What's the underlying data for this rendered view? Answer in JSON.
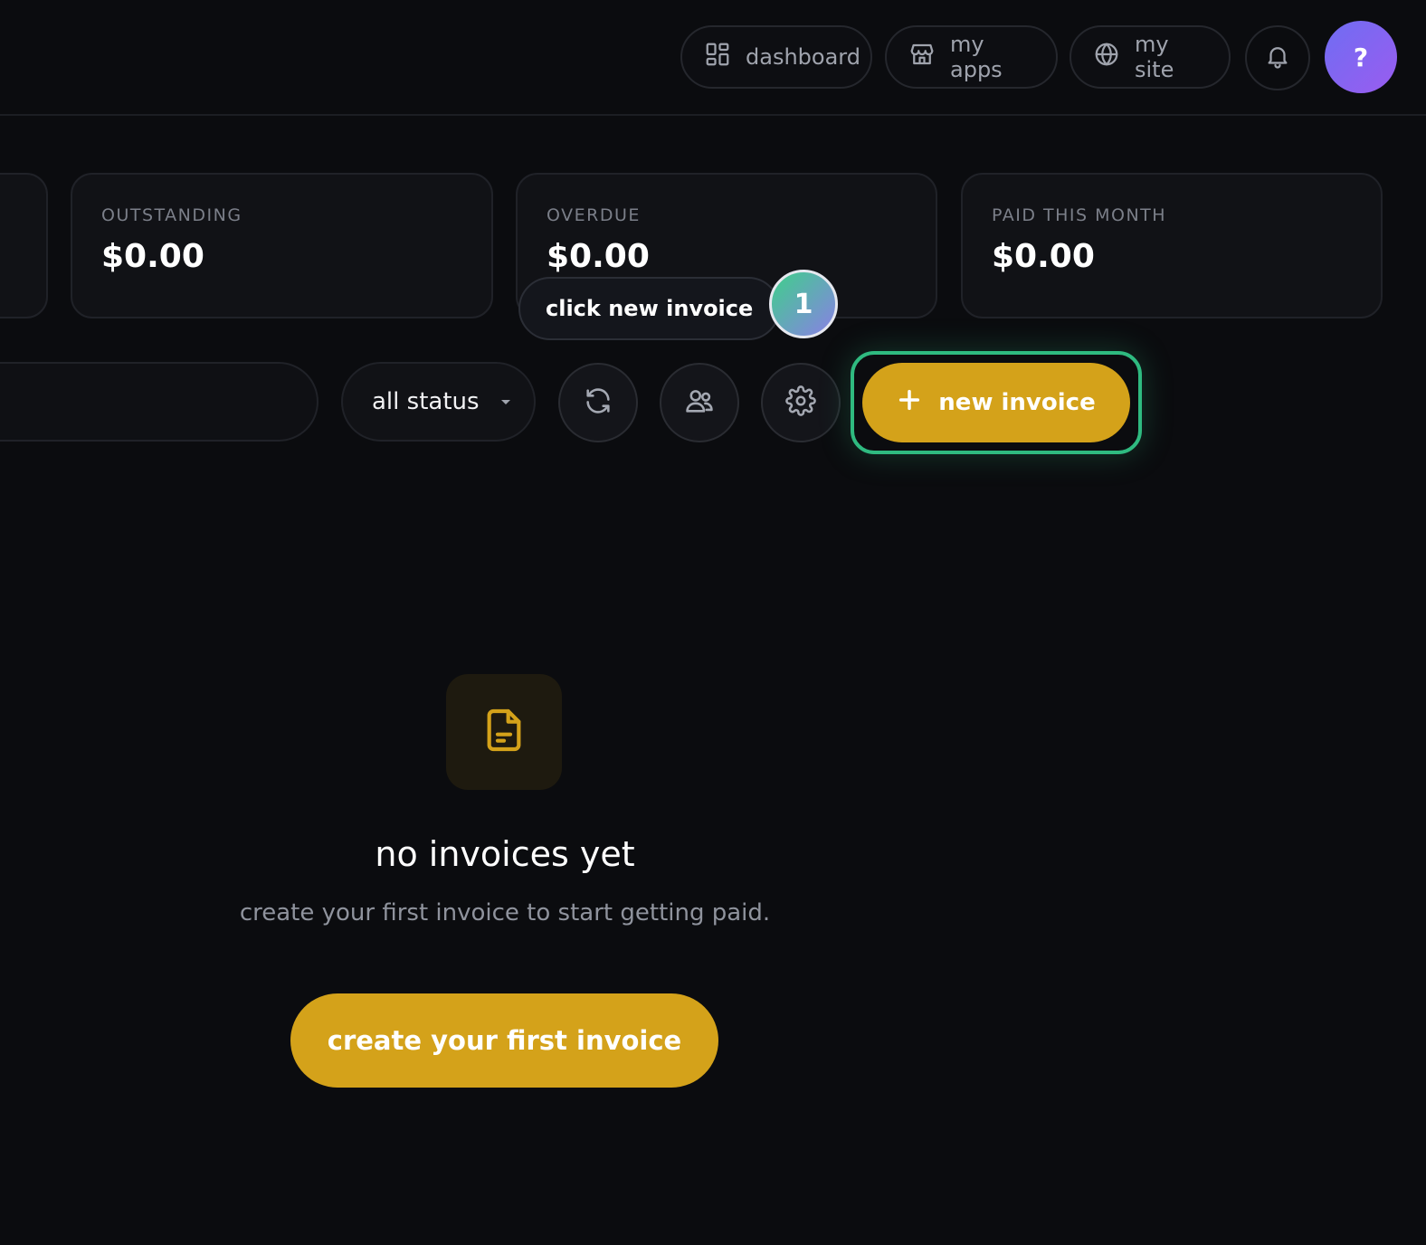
{
  "topbar": {
    "nav": [
      {
        "label": "dashboard",
        "icon": "dashboard-grid-icon"
      },
      {
        "label": "my apps",
        "icon": "storefront-icon"
      },
      {
        "label": "my site",
        "icon": "globe-icon"
      }
    ],
    "notifications_icon": "bell-icon",
    "avatar_text": "?"
  },
  "stats": [
    {
      "label": "OUTSTANDING",
      "value": "$0.00"
    },
    {
      "label": "OVERDUE",
      "value": "$0.00"
    },
    {
      "label": "PAID THIS MONTH",
      "value": "$0.00"
    }
  ],
  "toolbar": {
    "status_filter": "all status",
    "new_invoice_label": "new invoice"
  },
  "guide": {
    "tooltip": "click new invoice",
    "step": "1"
  },
  "empty_state": {
    "title": "no invoices yet",
    "subtitle": "create your first invoice to start getting paid.",
    "cta": "create your first invoice"
  },
  "colors": {
    "background": "#0b0c0f",
    "accent": "#d4a21a",
    "highlight": "#2fba80",
    "avatar": "#7a66f0"
  }
}
